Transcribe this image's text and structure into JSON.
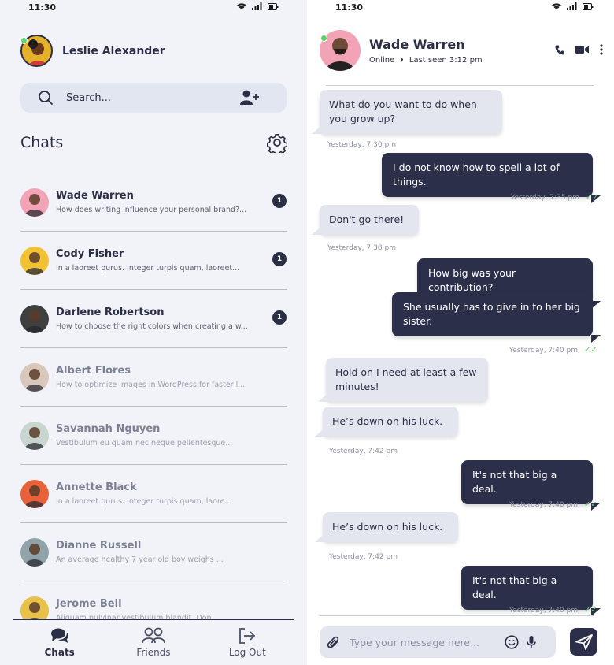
{
  "status": {
    "time": "11:30"
  },
  "me": {
    "name": "Leslie Alexander"
  },
  "search": {
    "placeholder": "Search..."
  },
  "chats_title": "Chats",
  "chat_list": [
    {
      "name": "Wade Warren",
      "preview": "How does writing influence your personal brand?...",
      "unread": "1",
      "avatar_bg": "#f3a3b6",
      "read": false
    },
    {
      "name": "Cody Fisher",
      "preview": "In a laoreet purus. Integer turpis quam, laoreet...",
      "unread": "1",
      "avatar_bg": "#f1c232",
      "read": false
    },
    {
      "name": "Darlene Robertson",
      "preview": "How to choose the right colors when creating a w...",
      "unread": "1",
      "avatar_bg": "#3f3f3f",
      "read": false
    },
    {
      "name": "Albert Flores",
      "preview": "How to optimize images in WordPress for faster l...",
      "unread": "",
      "avatar_bg": "#d9c7bb",
      "read": true
    },
    {
      "name": "Savannah Nguyen",
      "preview": "Vestibulum eu quam nec neque pellentesque...",
      "unread": "",
      "avatar_bg": "#c9d6cf",
      "read": true
    },
    {
      "name": "Annette Black",
      "preview": "In a laoreet purus. Integer turpis quam, laore...",
      "unread": "",
      "avatar_bg": "#e8613a",
      "read": true
    },
    {
      "name": "Dianne Russell",
      "preview": "An average healthy 7 year old boy weighs ...",
      "unread": "",
      "avatar_bg": "#8fa3a8",
      "read": true
    },
    {
      "name": "Jerome Bell",
      "preview": "Aliquam pulvinar vestibulum blandit. Don...",
      "unread": "",
      "avatar_bg": "#e7c14a",
      "read": true
    }
  ],
  "nav": {
    "chats": "Chats",
    "friends": "Friends",
    "logout": "Log Out"
  },
  "conversation": {
    "name": "Wade Warren",
    "status": "Online",
    "last_seen": "Last seen 3:12 pm",
    "messages": [
      {
        "text": "What do you want to do when you grow up?",
        "dir": "in",
        "time": "Yesterday, 7:30 pm"
      },
      {
        "text": "I do not know how to spell a lot of things.",
        "dir": "out",
        "time": "Yesterday, 7:35 pm"
      },
      {
        "text": "Don't go there!",
        "dir": "in",
        "time": "Yesterday, 7:38 pm"
      },
      {
        "text": "How big was your contribution?",
        "dir": "out",
        "time": ""
      },
      {
        "text": "She usually has to give in to her big sister.",
        "dir": "out",
        "time": "Yesterday, 7:40 pm"
      },
      {
        "text": "Hold on I need at least a few minutes!",
        "dir": "in",
        "time": ""
      },
      {
        "text": "He’s down on his luck.",
        "dir": "in",
        "time": "Yesterday, 7:42 pm"
      },
      {
        "text": "It's not that big a deal.",
        "dir": "out",
        "time": "Yesterday, 7:40 pm"
      },
      {
        "text": "He’s down on his luck.",
        "dir": "in",
        "time": "Yesterday, 7:42 pm"
      },
      {
        "text": "It's not that big a deal.",
        "dir": "out",
        "time": "Yesterday, 7:40 pm"
      }
    ]
  },
  "composer": {
    "placeholder": "Type your message here..."
  },
  "colors": {
    "primary": "#2b2f4a",
    "online": "#5ed36a",
    "bubble_in": "#e3e6ef"
  },
  "icons": [
    "search-icon",
    "add-user-icon",
    "gear-icon",
    "chat-icon",
    "friends-icon",
    "logout-icon",
    "phone-icon",
    "video-icon",
    "more-icon",
    "paperclip-icon",
    "emoji-icon",
    "mic-icon",
    "send-icon",
    "wifi-icon",
    "signal-icon",
    "battery-icon"
  ]
}
